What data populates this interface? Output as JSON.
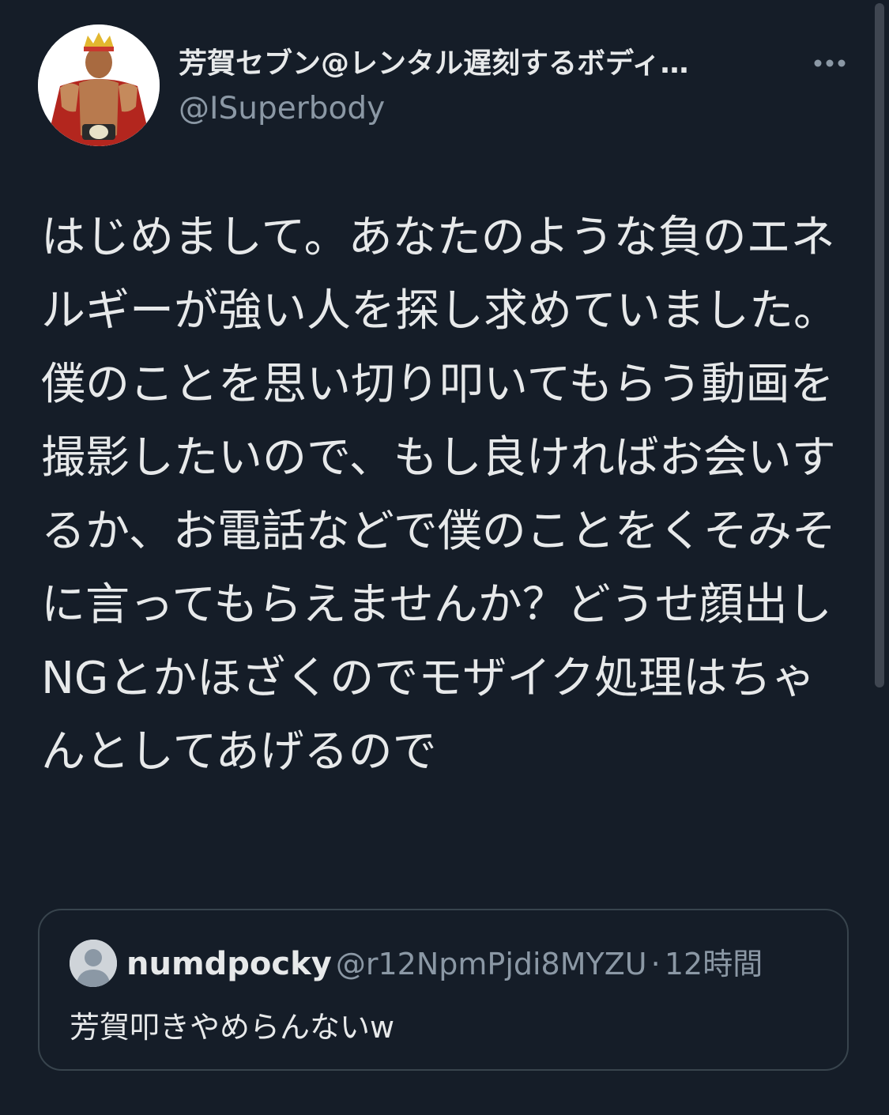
{
  "tweet": {
    "author": {
      "display_name": "芳賀セブン@レンタル遅刻するボディ…",
      "handle": "@ISuperbody",
      "avatar_icon": "profile-photo"
    },
    "more_icon": "ellipsis-icon",
    "text": "はじめまして。あなたのような負のエネルギーが強い人を探し求めていました。僕のことを思い切り叩いてもらう動画を撮影したいので、もし良ければお会いするか、お電話などで僕のことをくそみそに言ってもらえませんか？どうせ顔出しNGとかほざくのでモザイク処理はちゃんとしてあげるので"
  },
  "quoted_tweet": {
    "display_name": "numdpocky",
    "handle": "@r12NpmPjdi8MYZU",
    "separator": "·",
    "time": "12時間",
    "text": "芳賀叩きやめらんないw",
    "avatar_icon": "default-avatar-icon"
  },
  "colors": {
    "background": "#151d28",
    "primary_text": "#e7e9ea",
    "secondary_text": "#8b98a5",
    "border": "#38444d"
  }
}
